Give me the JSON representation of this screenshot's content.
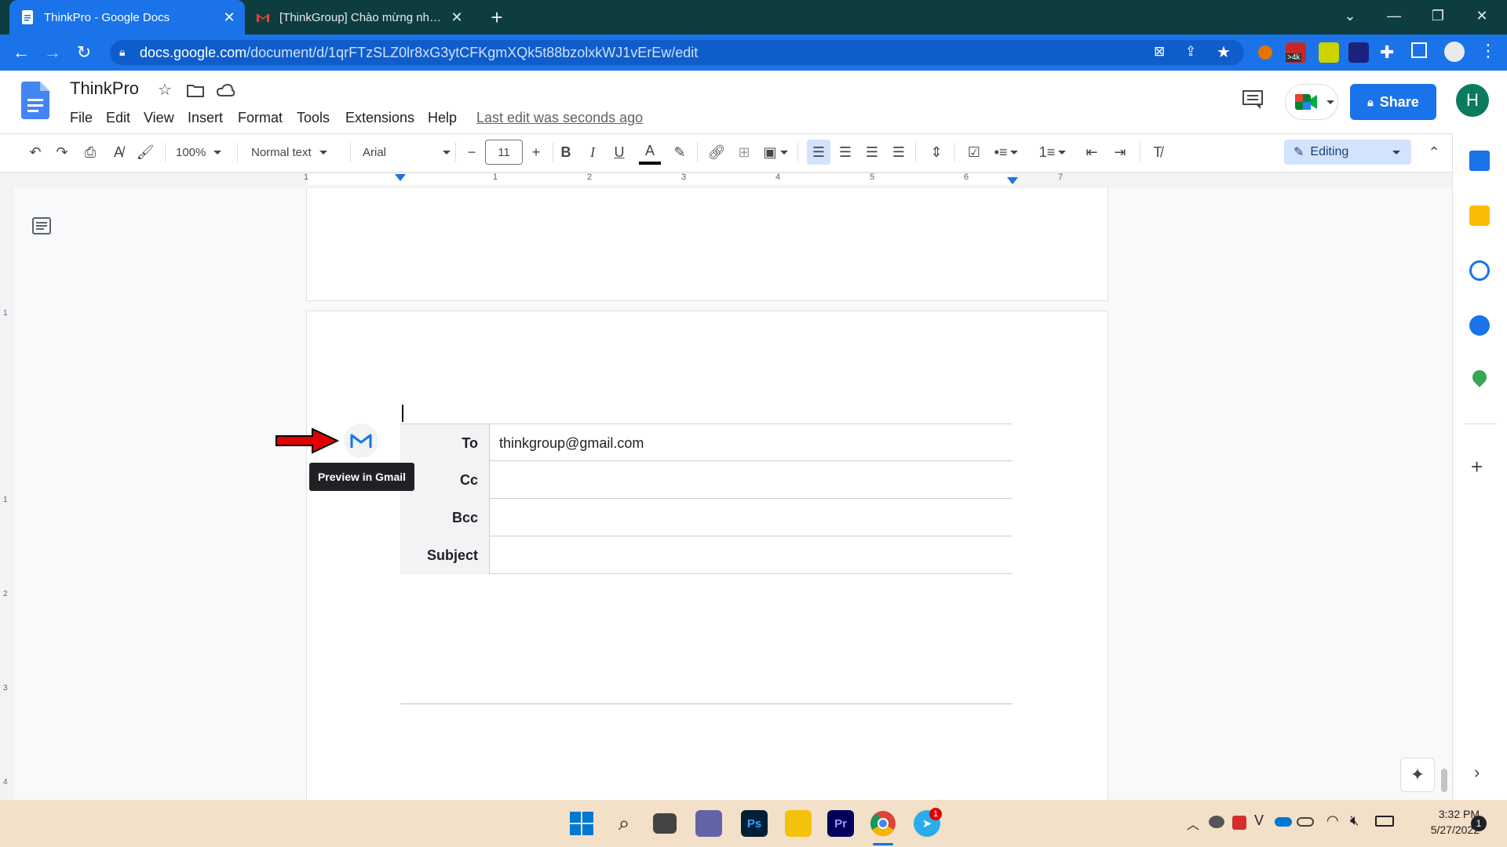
{
  "browser": {
    "tabs": [
      {
        "title": "ThinkPro - Google Docs",
        "active": true
      },
      {
        "title": "[ThinkGroup] Chào mừng nhân sự",
        "active": false
      }
    ],
    "url_host": "docs.google.com",
    "url_path": "/document/d/1qrFTzSLZ0lr8xG3ytCFKgmXQk5t88bzolxkWJ1vErEw/edit",
    "extension_badge": ">4k"
  },
  "docs": {
    "title": "ThinkPro",
    "menu": [
      "File",
      "Edit",
      "View",
      "Insert",
      "Format",
      "Tools",
      "Extensions",
      "Help"
    ],
    "last_edit": "Last edit was seconds ago",
    "share_label": "Share",
    "avatar_letter": "H",
    "toolbar": {
      "zoom": "100%",
      "style": "Normal text",
      "font": "Arial",
      "font_size": "11",
      "mode": "Editing"
    },
    "ruler_numbers": [
      "1",
      "1",
      "2",
      "3",
      "4",
      "5",
      "6",
      "7"
    ],
    "vruler_numbers": [
      "1",
      "1",
      "2",
      "3",
      "4"
    ]
  },
  "email_draft": {
    "rows": [
      {
        "label": "To",
        "value": "thinkgroup@gmail.com"
      },
      {
        "label": "Cc",
        "value": ""
      },
      {
        "label": "Bcc",
        "value": ""
      },
      {
        "label": "Subject",
        "value": ""
      }
    ],
    "gmail_tooltip": "Preview in Gmail"
  },
  "taskbar": {
    "time": "3:32 PM",
    "date": "5/27/2022",
    "notification_count": "1",
    "telegram_badge": "1",
    "ps_label": "Ps",
    "pr_label": "Pr"
  },
  "colors": {
    "accent": "#1a73e8",
    "tabstrip": "#0e3d3f",
    "arrow": "#e00000"
  }
}
